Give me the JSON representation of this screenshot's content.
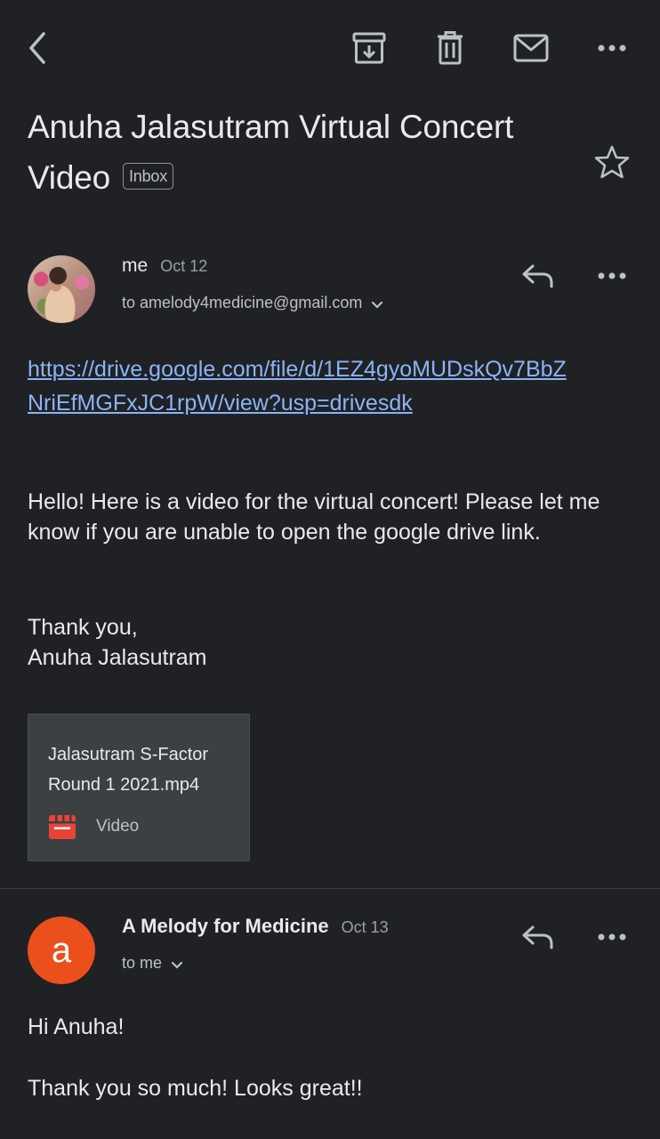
{
  "toolbar": {
    "back_icon": "chevron-left-icon",
    "archive_icon": "archive-icon",
    "delete_icon": "trash-icon",
    "mark_unread_icon": "mail-icon",
    "more_icon": "more-horizontal-icon"
  },
  "subject": {
    "title": "Anuha Jalasutram Virtual Concert Video",
    "label": "Inbox",
    "star_icon": "star-outline-icon"
  },
  "messages": [
    {
      "sender": "me",
      "date": "Oct 12",
      "recipient": "to amelody4medicine@gmail.com",
      "avatar_icon": "profile-photo",
      "link": "https://drive.google.com/file/d/1EZ4gyoMUDskQv7BbZNriEfMGFxJC1rpW/view?usp=drivesdk",
      "body": "Hello! Here is a video for the virtual concert! Please let me know if you are unable to open the google drive link.",
      "signoff_line1": "Thank you,",
      "signoff_line2": "Anuha Jalasutram",
      "attachment": {
        "filename": "Jalasutram S-Factor Round 1 2021.mp4",
        "type": "Video",
        "icon": "video-clapper-icon"
      }
    },
    {
      "sender": "A Melody for Medicine",
      "date": "Oct 13",
      "recipient": "to me",
      "avatar_letter": "a",
      "avatar_color": "#ea4f1c",
      "greeting": "Hi Anuha!",
      "body": "Thank you so much! Looks great!!"
    }
  ],
  "colors": {
    "background": "#202124",
    "link": "#8ab4f8",
    "attachment_bg": "#3c4043",
    "video_icon": "#ea4335"
  }
}
